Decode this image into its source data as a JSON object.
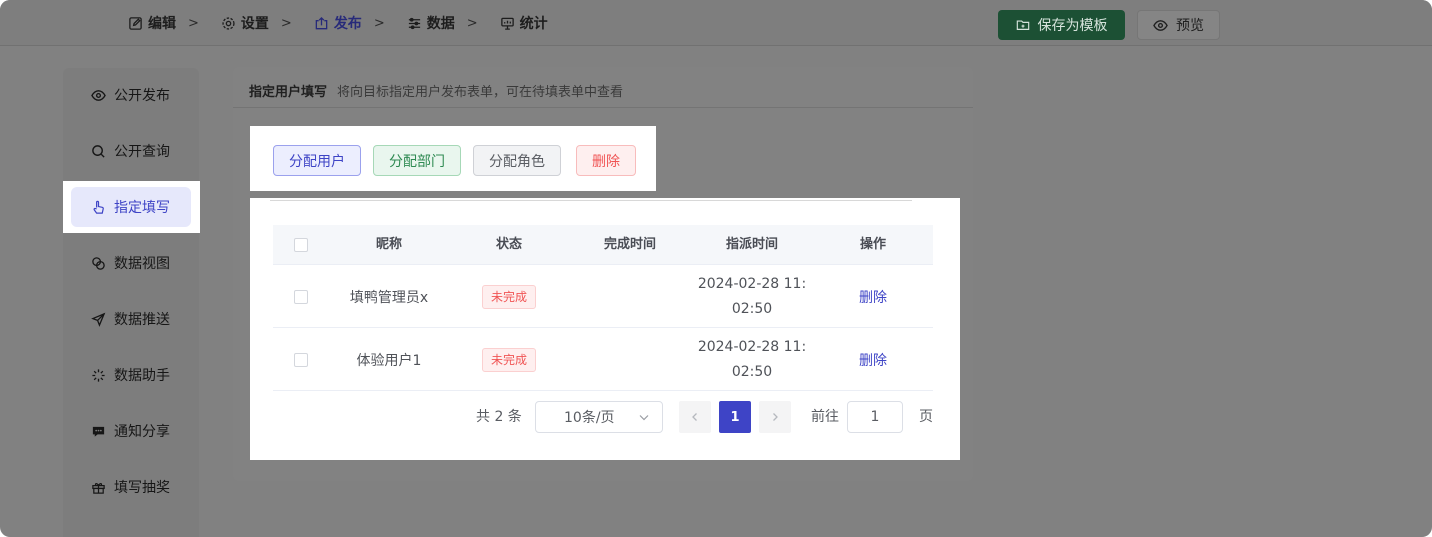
{
  "steps": [
    {
      "label": "编辑",
      "icon": "edit-icon",
      "active": false
    },
    {
      "label": "设置",
      "icon": "gear-icon",
      "active": false
    },
    {
      "label": "发布",
      "icon": "upload-icon",
      "active": true
    },
    {
      "label": "数据",
      "icon": "sliders-icon",
      "active": false
    },
    {
      "label": "统计",
      "icon": "presentation-chart-icon",
      "active": false
    }
  ],
  "step_separator": ">",
  "header": {
    "save_label": "保存为模板",
    "preview_label": "预览"
  },
  "sidebar": {
    "items": [
      {
        "label": "公开发布",
        "icon": "eye-icon"
      },
      {
        "label": "公开查询",
        "icon": "search-icon"
      },
      {
        "label": "指定填写",
        "icon": "pointer-hand-icon",
        "active": true
      },
      {
        "label": "数据视图",
        "icon": "overlap-circles-icon"
      },
      {
        "label": "数据推送",
        "icon": "send-icon"
      },
      {
        "label": "数据助手",
        "icon": "loading-spinner-icon"
      },
      {
        "label": "通知分享",
        "icon": "chat-bubble-icon"
      },
      {
        "label": "填写抽奖",
        "icon": "gift-icon"
      },
      {
        "label": "",
        "icon": "more-icon"
      }
    ]
  },
  "card": {
    "title": "指定用户填写",
    "description": "将向目标指定用户发布表单，可在待填表单中查看"
  },
  "actions": {
    "assign_user": "分配用户",
    "assign_dept": "分配部门",
    "assign_role": "分配角色",
    "delete": "删除"
  },
  "table": {
    "columns": [
      "昵称",
      "状态",
      "完成时间",
      "指派时间",
      "操作"
    ],
    "rows": [
      {
        "nickname": "填鸭管理员x",
        "status": "未完成",
        "finish_time": "",
        "assign_time_1": "2024-02-28 11:",
        "assign_time_2": "02:50",
        "action": "删除"
      },
      {
        "nickname": "体验用户1",
        "status": "未完成",
        "finish_time": "",
        "assign_time_1": "2024-02-28 11:",
        "assign_time_2": "02:50",
        "action": "删除"
      }
    ]
  },
  "pagination": {
    "total": "共 2 条",
    "page_size": "10条/页",
    "current_page": "1",
    "goto_label": "前往",
    "goto_value": "1",
    "page_unit": "页"
  },
  "colors": {
    "accent": "#3e44c6",
    "save": "#1c5034",
    "danger": "#f05454",
    "success": "#2e8a52"
  }
}
